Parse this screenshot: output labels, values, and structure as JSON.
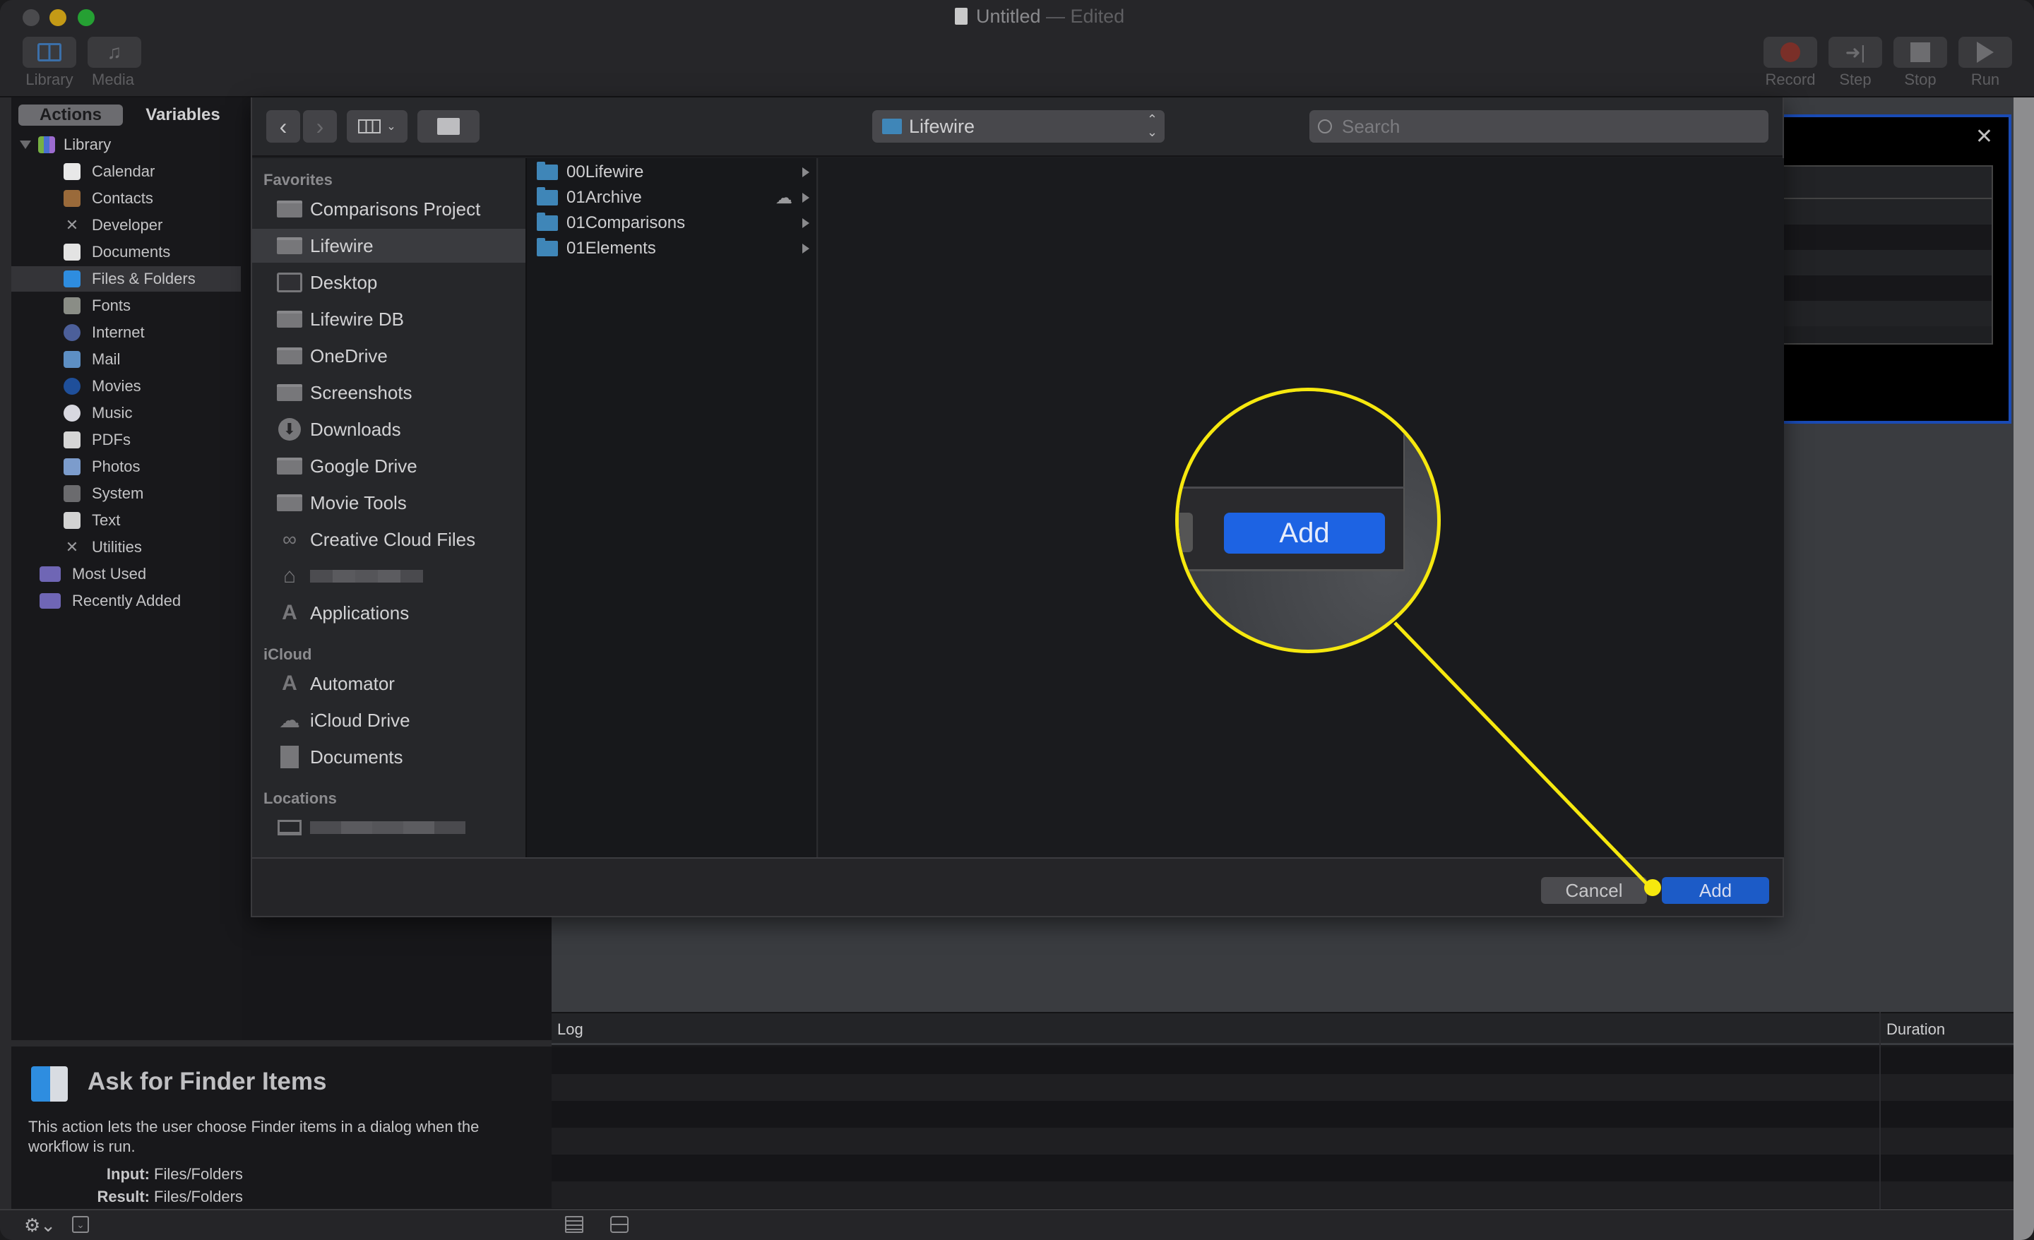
{
  "window": {
    "title": "Untitled",
    "title_suffix": " — Edited"
  },
  "toolbar": {
    "left_buttons": [
      {
        "label": "Library",
        "icon": "library-icon"
      },
      {
        "label": "Media",
        "icon": "media-icon"
      }
    ],
    "right_buttons": [
      {
        "label": "Record",
        "icon": "record-icon"
      },
      {
        "label": "Step",
        "icon": "step-icon"
      },
      {
        "label": "Stop",
        "icon": "stop-icon"
      },
      {
        "label": "Run",
        "icon": "run-icon"
      }
    ]
  },
  "library_panel": {
    "tabs": [
      {
        "label": "Actions",
        "selected": true
      },
      {
        "label": "Variables",
        "selected": false
      }
    ],
    "root": {
      "label": "Library",
      "expanded": true
    },
    "items": [
      {
        "label": "Calendar",
        "icon": "calendar-icon"
      },
      {
        "label": "Contacts",
        "icon": "contacts-icon"
      },
      {
        "label": "Developer",
        "icon": "developer-icon"
      },
      {
        "label": "Documents",
        "icon": "documents-icon"
      },
      {
        "label": "Files & Folders",
        "icon": "finder-icon",
        "selected": true
      },
      {
        "label": "Fonts",
        "icon": "fonts-icon"
      },
      {
        "label": "Internet",
        "icon": "internet-icon"
      },
      {
        "label": "Mail",
        "icon": "mail-icon"
      },
      {
        "label": "Movies",
        "icon": "movies-icon"
      },
      {
        "label": "Music",
        "icon": "music-icon"
      },
      {
        "label": "PDFs",
        "icon": "pdfs-icon"
      },
      {
        "label": "Photos",
        "icon": "photos-icon"
      },
      {
        "label": "System",
        "icon": "system-icon"
      },
      {
        "label": "Text",
        "icon": "text-icon"
      },
      {
        "label": "Utilities",
        "icon": "utilities-icon"
      }
    ],
    "smart_groups": [
      {
        "label": "Most Used",
        "icon": "smart-folder-icon"
      },
      {
        "label": "Recently Added",
        "icon": "smart-folder-icon"
      }
    ]
  },
  "description": {
    "title": "Ask for Finder Items",
    "body": "This action lets the user choose Finder items in a dialog when the workflow is run.",
    "input_label": "Input:",
    "input_value": "Files/Folders",
    "result_label": "Result:",
    "result_value": "Files/Folders"
  },
  "log": {
    "columns": [
      "Log",
      "Duration"
    ],
    "rows": []
  },
  "dialog": {
    "location": "Lifewire",
    "search_placeholder": "Search",
    "sidebar": {
      "sections": [
        {
          "header": "Favorites",
          "items": [
            {
              "label": "Comparisons Project",
              "icon": "folder-icon"
            },
            {
              "label": "Lifewire",
              "icon": "folder-icon",
              "selected": true
            },
            {
              "label": "Desktop",
              "icon": "desktop-icon"
            },
            {
              "label": "Lifewire DB",
              "icon": "folder-icon"
            },
            {
              "label": "OneDrive",
              "icon": "folder-icon"
            },
            {
              "label": "Screenshots",
              "icon": "folder-icon"
            },
            {
              "label": "Downloads",
              "icon": "downloads-icon"
            },
            {
              "label": "Google Drive",
              "icon": "folder-icon"
            },
            {
              "label": "Movie Tools",
              "icon": "folder-icon"
            },
            {
              "label": "Creative Cloud Files",
              "icon": "creative-cloud-icon"
            },
            {
              "label": "",
              "icon": "home-icon",
              "redacted": true
            },
            {
              "label": "Applications",
              "icon": "applications-icon"
            }
          ]
        },
        {
          "header": "iCloud",
          "items": [
            {
              "label": "Automator",
              "icon": "applications-icon"
            },
            {
              "label": "iCloud Drive",
              "icon": "icloud-icon"
            },
            {
              "label": "Documents",
              "icon": "icloud-documents-icon"
            }
          ]
        },
        {
          "header": "Locations",
          "items": [
            {
              "label": "",
              "icon": "laptop-icon",
              "redacted": true
            }
          ]
        }
      ]
    },
    "column_items": [
      {
        "label": "00Lifewire",
        "has_children": true,
        "cloud": false
      },
      {
        "label": "01Archive",
        "has_children": true,
        "cloud": true
      },
      {
        "label": "01Comparisons",
        "has_children": true,
        "cloud": false
      },
      {
        "label": "01Elements",
        "has_children": true,
        "cloud": false
      }
    ],
    "cancel_label": "Cancel",
    "add_label": "Add"
  },
  "callout": {
    "label": "Add",
    "color": "#f6e80e"
  },
  "colors": {
    "accent_blue": "#1c5bc7",
    "callout_yellow": "#f6e80e",
    "folder_blue": "#3f86b8"
  }
}
